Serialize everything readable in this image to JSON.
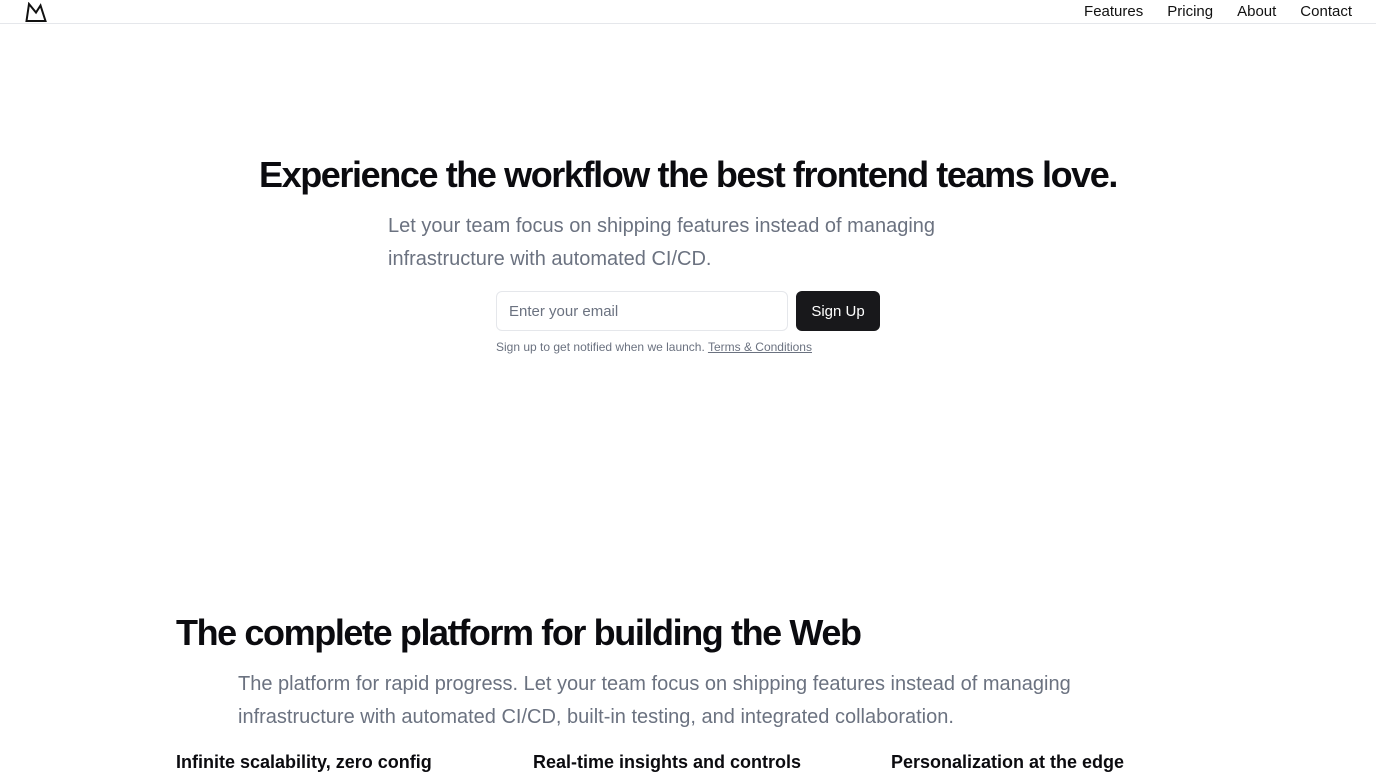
{
  "header": {
    "logo": "mountain-logo-icon",
    "nav": [
      "Features",
      "Pricing",
      "About",
      "Contact"
    ]
  },
  "hero": {
    "title": "Experience the workflow the best frontend teams love.",
    "subtitle": "Let your team focus on shipping features instead of managing infrastructure with automated CI/CD.",
    "email_placeholder": "Enter your email",
    "email_value": "",
    "signup_label": "Sign Up",
    "note": "Sign up to get notified when we launch.",
    "terms_label": "Terms & Conditions"
  },
  "platform": {
    "title": "The complete platform for building the Web",
    "subtitle": "The platform for rapid progress. Let your team focus on shipping features instead of managing infrastructure with automated CI/CD, built-in testing, and integrated collaboration.",
    "features": [
      {
        "title": "Infinite scalability, zero config"
      },
      {
        "title": "Real-time insights and controls"
      },
      {
        "title": "Personalization at the edge"
      }
    ]
  },
  "colors": {
    "primary_button": "#18181b",
    "muted_text": "#6b7280",
    "border": "#e5e7eb"
  }
}
